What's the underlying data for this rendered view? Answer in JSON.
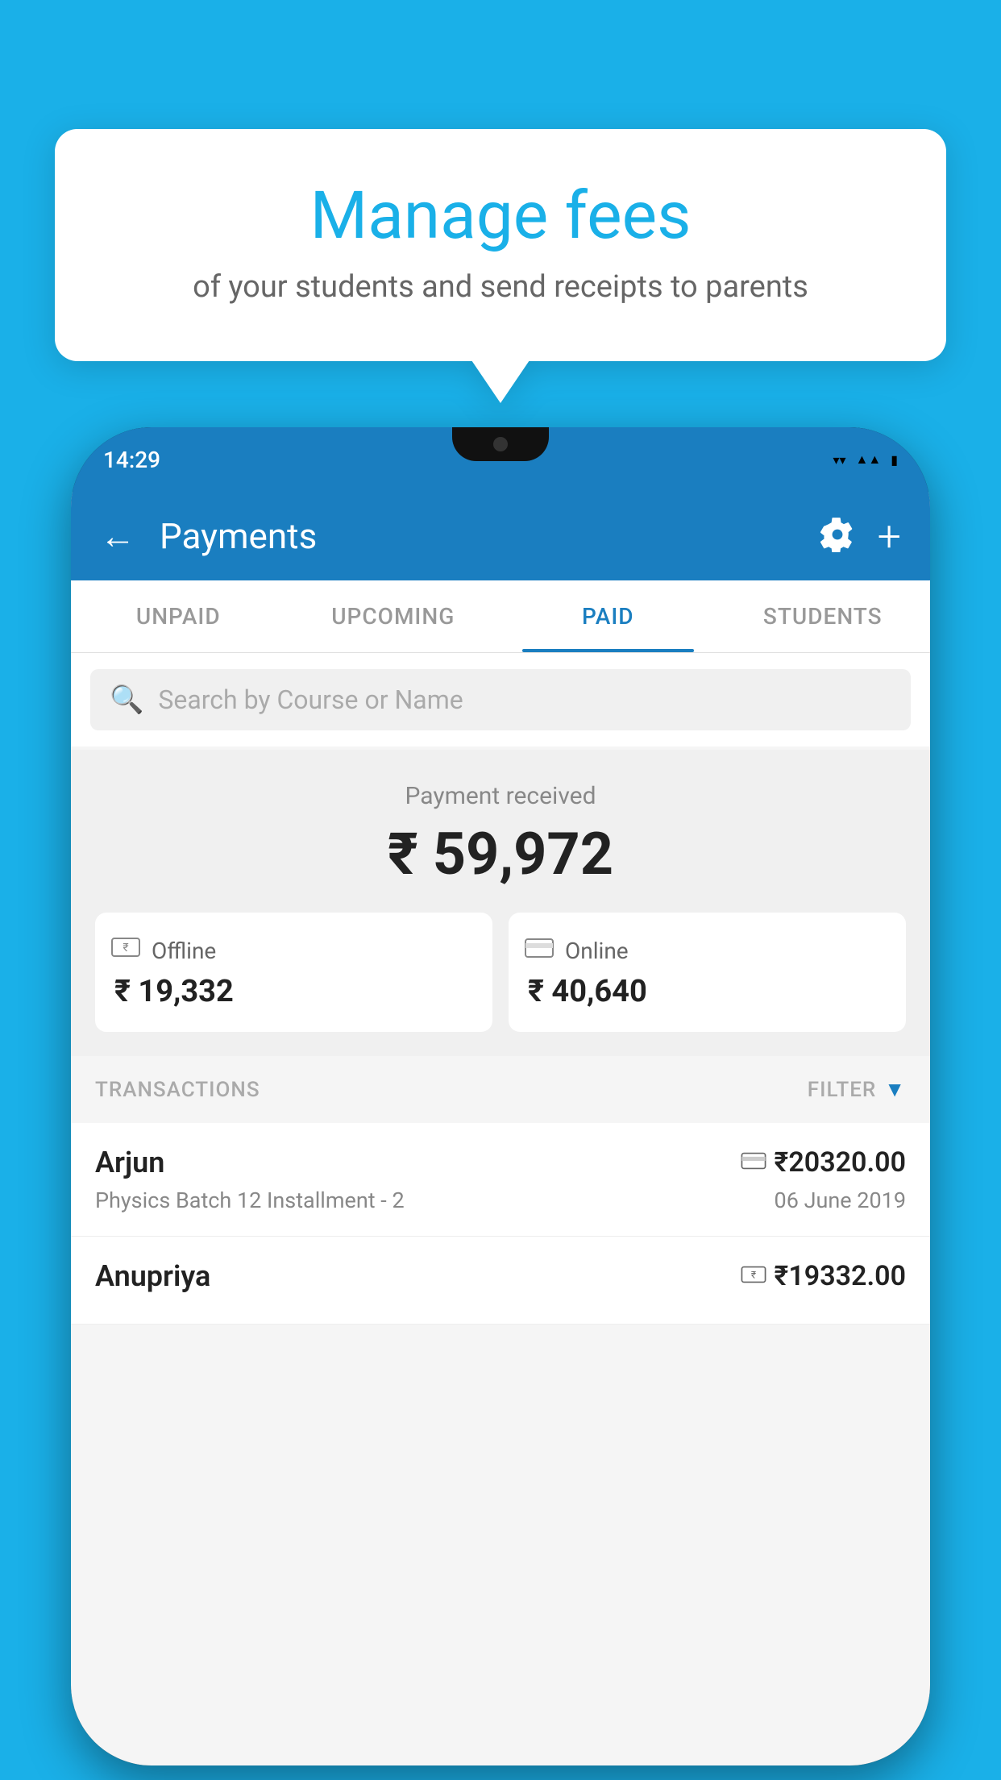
{
  "background_color": "#1ab0e8",
  "bubble": {
    "title": "Manage fees",
    "subtitle": "of your students and send receipts to parents"
  },
  "status_bar": {
    "time": "14:29",
    "icons": [
      "wifi",
      "signal",
      "battery"
    ]
  },
  "app": {
    "top_bar": {
      "back_label": "←",
      "title": "Payments",
      "settings_label": "⚙",
      "add_label": "+"
    },
    "tabs": [
      {
        "label": "UNPAID",
        "active": false
      },
      {
        "label": "UPCOMING",
        "active": false
      },
      {
        "label": "PAID",
        "active": true
      },
      {
        "label": "STUDENTS",
        "active": false
      }
    ],
    "search": {
      "placeholder": "Search by Course or Name"
    },
    "payment_summary": {
      "label": "Payment received",
      "amount": "₹ 59,972",
      "offline": {
        "label": "Offline",
        "amount": "₹ 19,332"
      },
      "online": {
        "label": "Online",
        "amount": "₹ 40,640"
      }
    },
    "transactions_header": {
      "label": "TRANSACTIONS",
      "filter_label": "FILTER"
    },
    "transactions": [
      {
        "name": "Arjun",
        "course": "Physics Batch 12 Installment - 2",
        "amount": "₹20320.00",
        "date": "06 June 2019",
        "type": "online"
      },
      {
        "name": "Anupriya",
        "course": "",
        "amount": "₹19332.00",
        "date": "",
        "type": "offline"
      }
    ]
  }
}
